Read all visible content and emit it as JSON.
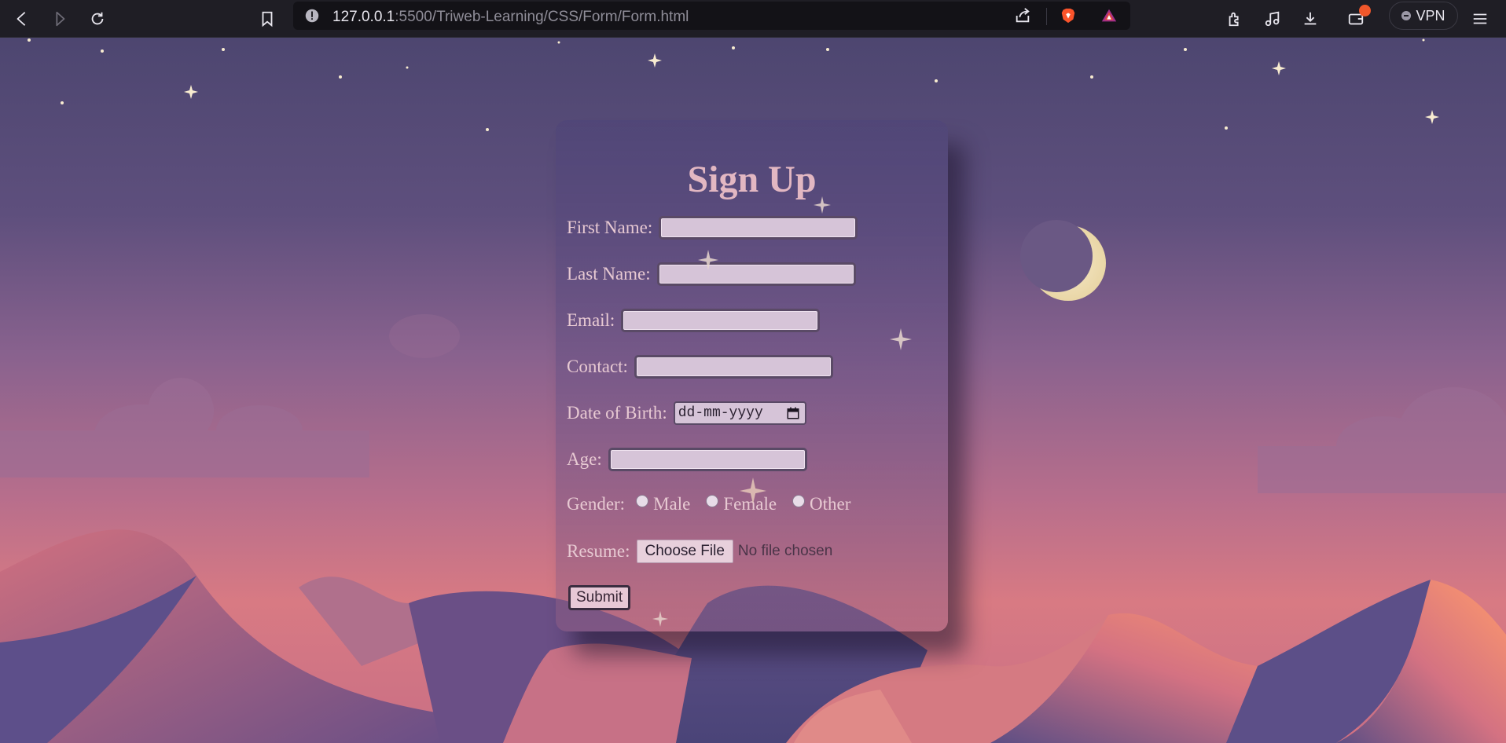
{
  "browser": {
    "url_host": "127.0.0.1",
    "url_rest": ":5500/Triweb-Learning/CSS/Form/Form.html",
    "vpn_label": "VPN",
    "icons": [
      "back-icon",
      "forward-icon",
      "reload-icon",
      "bookmark-icon",
      "site-info-icon",
      "share-icon",
      "brave-shields-icon",
      "brave-rewards-icon",
      "extensions-icon",
      "media-icon",
      "downloads-icon",
      "wallet-icon",
      "menu-icon"
    ]
  },
  "form": {
    "title": "Sign Up",
    "first_name_label": "First Name:",
    "last_name_label": "Last Name:",
    "email_label": "Email:",
    "contact_label": "Contact:",
    "dob_label": "Date of Birth:",
    "dob_placeholder": "dd-mm-yyyy",
    "age_label": "Age:",
    "gender_label": "Gender:",
    "gender_options": [
      "Male",
      "Female",
      "Other"
    ],
    "resume_label": "Resume:",
    "choose_file_label": "Choose File",
    "file_status": "No file chosen",
    "submit_label": "Submit"
  },
  "colors": {
    "card_text": "#e7c9d2",
    "title": "#e2b7c2",
    "input_bg": "#d6c4d8",
    "input_border": "#5a4a66"
  }
}
